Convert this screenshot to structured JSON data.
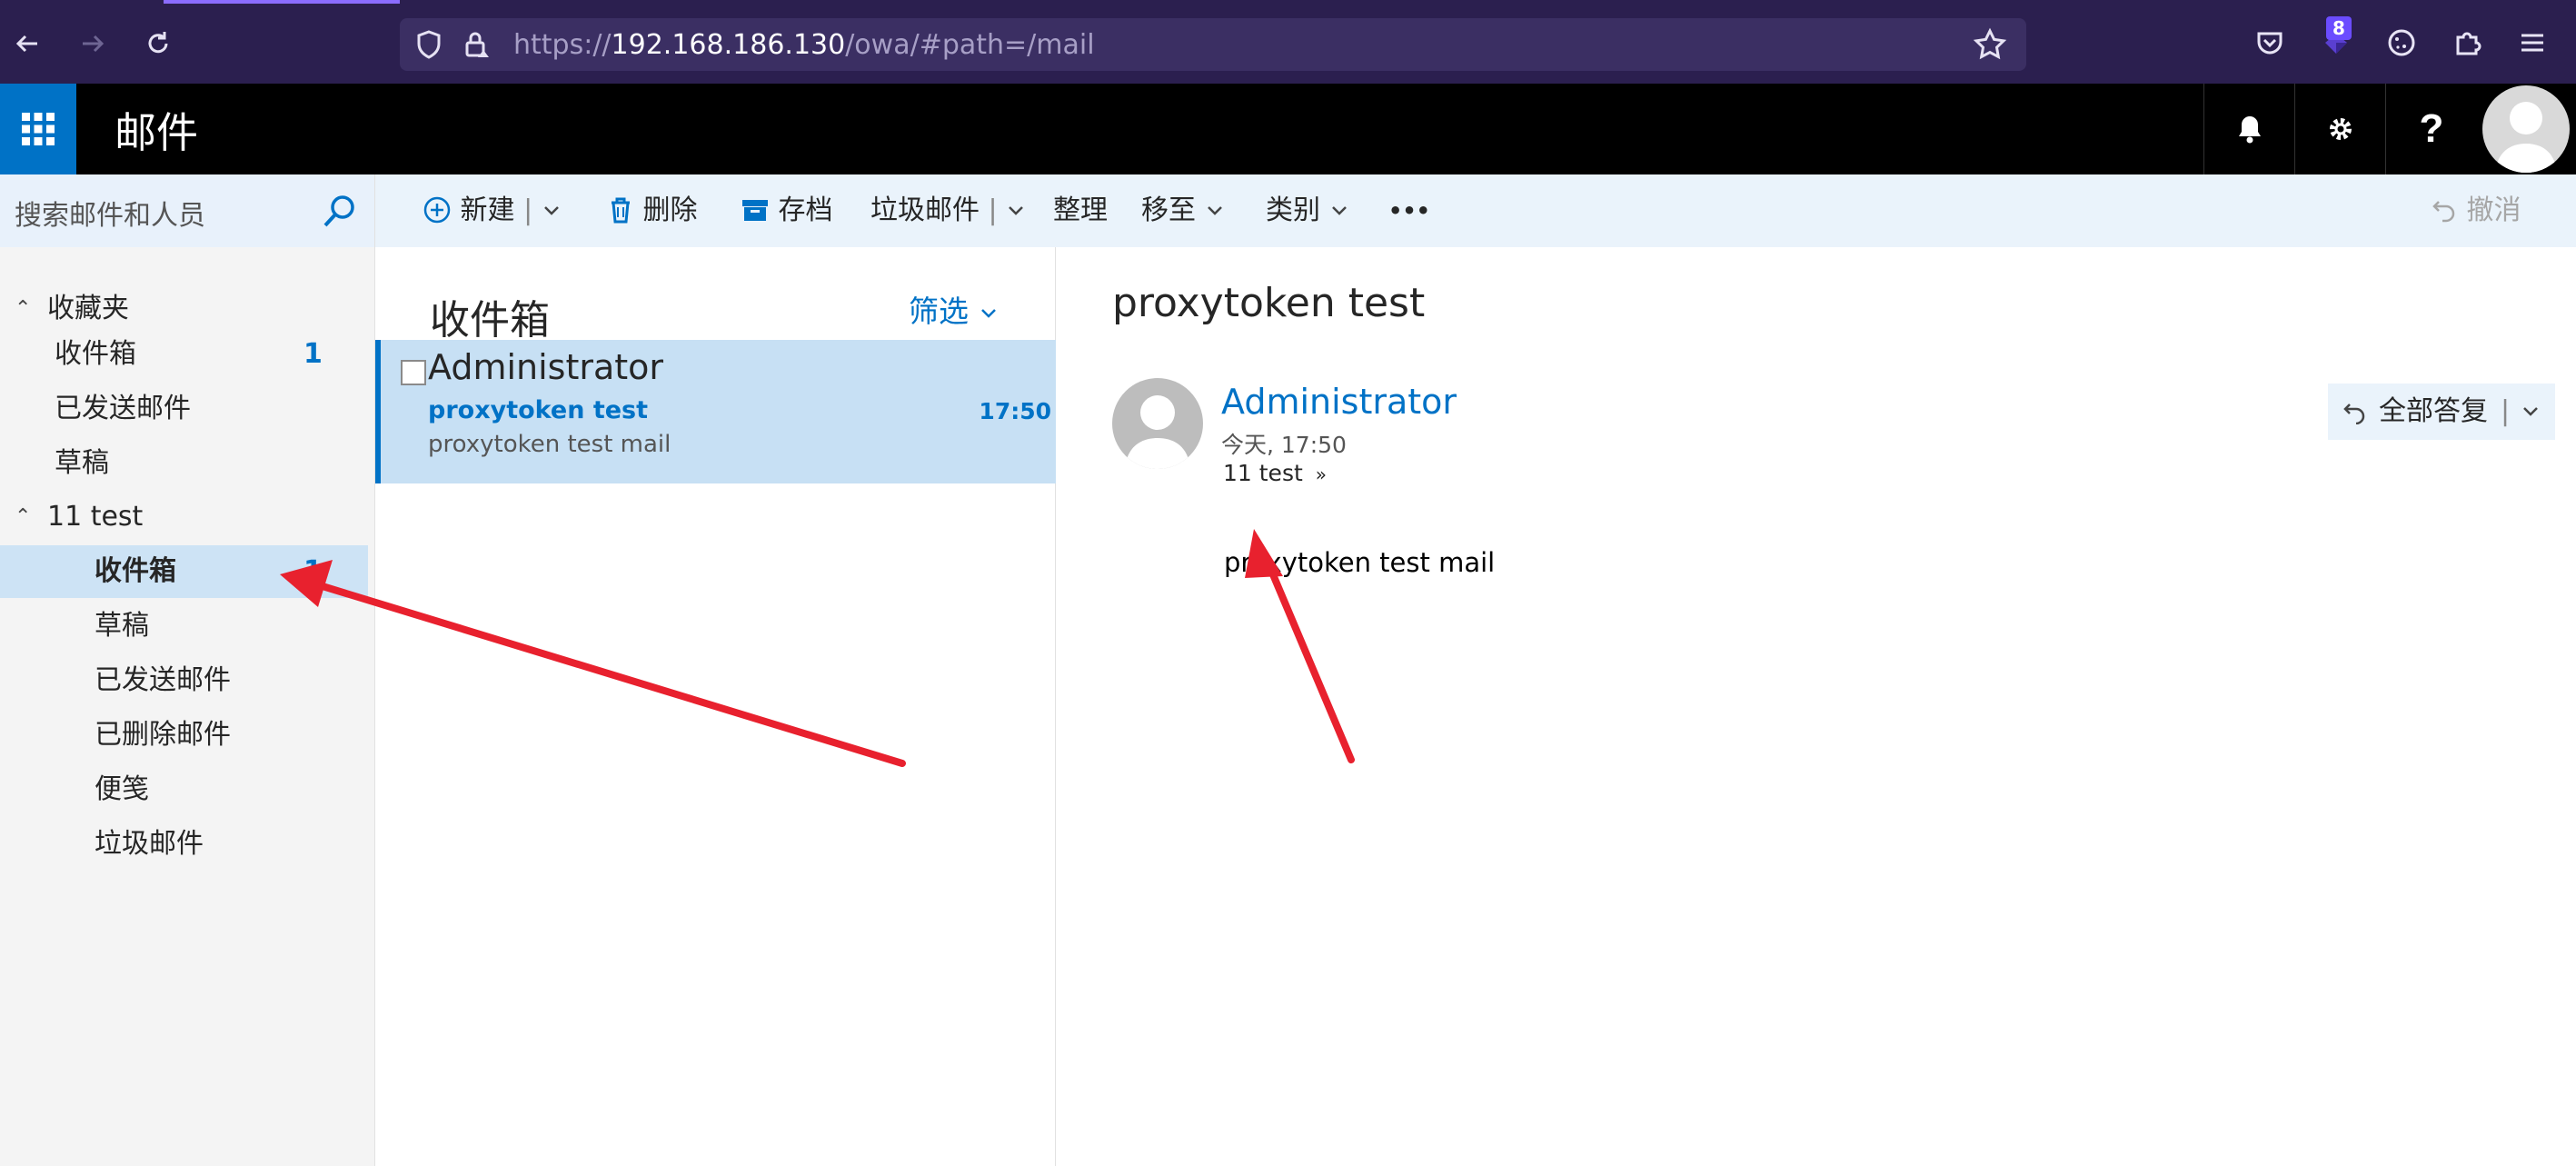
{
  "browser": {
    "url_prefix": "https://",
    "url_host": "192.168.186.130",
    "url_path": "/owa/#path=/mail",
    "extension_badge": "8",
    "icons": [
      "back-icon",
      "forward-icon",
      "reload-icon",
      "shield-icon",
      "lock-icon",
      "bookmark-star-icon",
      "pocket-icon",
      "extension-icon",
      "cookie-icon",
      "puzzle-icon",
      "menu-icon"
    ]
  },
  "header": {
    "title": "邮件",
    "icons": [
      "app-launcher-icon",
      "bell-icon",
      "gear-icon",
      "help-icon",
      "avatar-icon"
    ]
  },
  "search": {
    "placeholder": "搜索邮件和人员"
  },
  "sidebar": {
    "favorites": {
      "label": "收藏夹",
      "items": [
        {
          "label": "收件箱",
          "count": "1"
        },
        {
          "label": "已发送邮件",
          "count": ""
        },
        {
          "label": "草稿",
          "count": ""
        }
      ]
    },
    "account": {
      "label": "11 test",
      "items": [
        {
          "label": "收件箱",
          "count": "1"
        },
        {
          "label": "草稿",
          "count": ""
        },
        {
          "label": "已发送邮件",
          "count": ""
        },
        {
          "label": "已删除邮件",
          "count": ""
        },
        {
          "label": "便笺",
          "count": ""
        },
        {
          "label": "垃圾邮件",
          "count": ""
        }
      ]
    }
  },
  "toolbar": {
    "new": "新建",
    "delete": "删除",
    "archive": "存档",
    "junk": "垃圾邮件",
    "sweep": "整理",
    "move_to": "移至",
    "categories": "类别",
    "more": "•••",
    "undo": "撤消"
  },
  "message_list": {
    "title": "收件箱",
    "filter": "筛选",
    "items": [
      {
        "sender": "Administrator",
        "subject": "proxytoken test",
        "preview": "proxytoken test mail",
        "time": "17:50"
      }
    ]
  },
  "reading_pane": {
    "subject": "proxytoken test",
    "from": "Administrator",
    "date": "今天, 17:50",
    "to": "11 test",
    "reply_all": "全部答复",
    "body": "proxytoken test mail"
  },
  "colors": {
    "browser_bg": "#2b1f4f",
    "accent": "#0072c6",
    "selected_bg": "#c7e0f4",
    "annotation": "#e8212e"
  }
}
